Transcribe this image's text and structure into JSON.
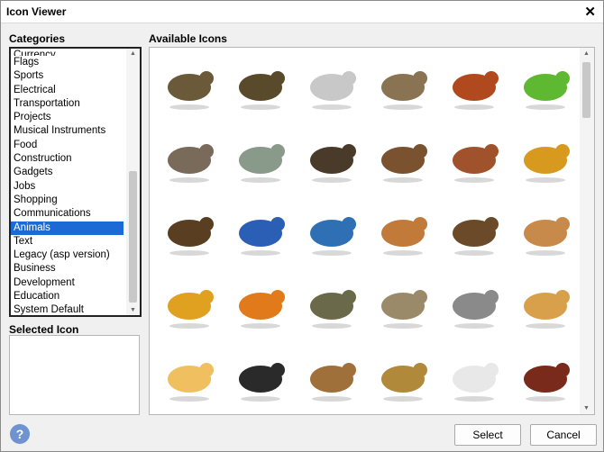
{
  "window": {
    "title": "Icon Viewer",
    "close_symbol": "✕"
  },
  "categories": {
    "label": "Categories",
    "partial_top_item": "Currency",
    "items": [
      "Flags",
      "Sports",
      "Electrical",
      "Transportation",
      "Projects",
      "Musical Instruments",
      "Food",
      "Construction",
      "Gadgets",
      "Jobs",
      "Shopping",
      "Communications",
      "Animals",
      "Text",
      "Legacy (asp version)",
      "Business",
      "Development",
      "Education",
      "System Default"
    ],
    "selected": "Animals"
  },
  "selected_icon": {
    "label": "Selected Icon"
  },
  "available_icons": {
    "label": "Available Icons",
    "icons": [
      {
        "name": "alligator-icon",
        "color": "#6b5a3a"
      },
      {
        "name": "snake-icon",
        "color": "#5a4a2c"
      },
      {
        "name": "angelfish-icon",
        "color": "#c8c8c8"
      },
      {
        "name": "antelope-icon",
        "color": "#8a7352"
      },
      {
        "name": "ant-icon",
        "color": "#b04a1e"
      },
      {
        "name": "parakeet-icon",
        "color": "#5fb832"
      },
      {
        "name": "baboon-icon",
        "color": "#7a6a5a"
      },
      {
        "name": "bass-fish-icon",
        "color": "#8a9a8a"
      },
      {
        "name": "bat-icon",
        "color": "#4a3a2a"
      },
      {
        "name": "bear-icon",
        "color": "#7a5230"
      },
      {
        "name": "beetle-icon",
        "color": "#a0522d"
      },
      {
        "name": "bee-icon",
        "color": "#d79a1e"
      },
      {
        "name": "bison-icon",
        "color": "#5a3e22"
      },
      {
        "name": "bluebird-icon",
        "color": "#2b5fb5"
      },
      {
        "name": "whale-icon",
        "color": "#2f6fb4"
      },
      {
        "name": "boxer-dog-icon",
        "color": "#c27a3a"
      },
      {
        "name": "buffalo-icon",
        "color": "#6a4a28"
      },
      {
        "name": "bulldog-icon",
        "color": "#c88a4a"
      },
      {
        "name": "butterflyfish-icon",
        "color": "#e0a020"
      },
      {
        "name": "monarch-butterfly-icon",
        "color": "#e07a1a"
      },
      {
        "name": "caterpillar-icon",
        "color": "#6a6a4a"
      },
      {
        "name": "catfish-icon",
        "color": "#9a8a6a"
      },
      {
        "name": "cat-icon",
        "color": "#8a8a8a"
      },
      {
        "name": "cheetah-icon",
        "color": "#d8a04a"
      },
      {
        "name": "chick-icon",
        "color": "#f0c060"
      },
      {
        "name": "chimpanzee-icon",
        "color": "#2a2a2a"
      },
      {
        "name": "chipmunk-icon",
        "color": "#a0703a"
      },
      {
        "name": "cobra-icon",
        "color": "#b08a3a"
      },
      {
        "name": "cockatoo-icon",
        "color": "#e8e8e8"
      },
      {
        "name": "cockroach-icon",
        "color": "#7a2a1a"
      }
    ]
  },
  "buttons": {
    "select": "Select",
    "cancel": "Cancel",
    "help": "?"
  }
}
